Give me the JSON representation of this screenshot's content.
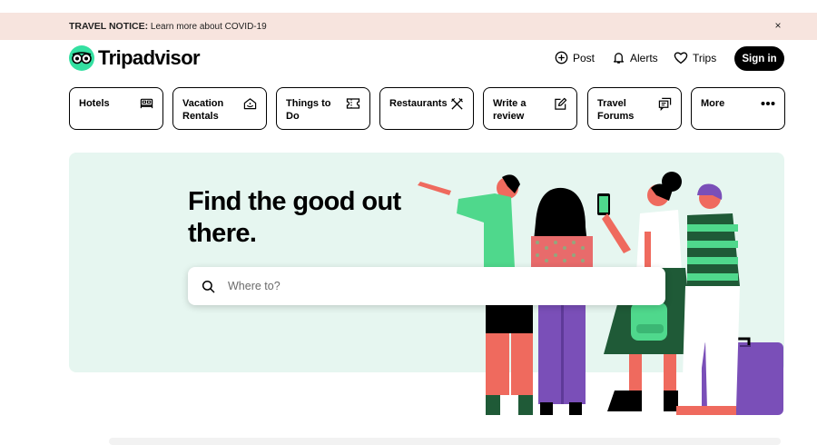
{
  "notice": {
    "title": "TRAVEL NOTICE:",
    "link": "Learn more about COVID-19",
    "close_glyph": "×"
  },
  "header": {
    "logo_text": "Tripadvisor",
    "logo_icon": "owl-eyes-icon",
    "actions": [
      {
        "label": "Post",
        "icon": "plus-circle-icon"
      },
      {
        "label": "Alerts",
        "icon": "bell-icon"
      },
      {
        "label": "Trips",
        "icon": "heart-icon"
      }
    ],
    "signin_label": "Sign in"
  },
  "nav": [
    {
      "label": "Hotels",
      "icon": "bed-icon"
    },
    {
      "label": "Vacation Rentals",
      "icon": "house-icon"
    },
    {
      "label": "Things to Do",
      "icon": "ticket-icon"
    },
    {
      "label": "Restaurants",
      "icon": "fork-knife-icon"
    },
    {
      "label": "Write a review",
      "icon": "pencil-square-icon"
    },
    {
      "label": "Travel Forums",
      "icon": "chat-bubbles-icon"
    },
    {
      "label": "More",
      "icon": "ellipsis-icon"
    }
  ],
  "hero": {
    "title": "Find the good out there.",
    "search_placeholder": "Where to?",
    "search_icon": "search-icon",
    "illustration": "group-of-travelers-illustration"
  },
  "colors": {
    "brand_green": "#34e0a1",
    "notice_bg": "#f7e4de",
    "hero_bg": "#e6f6f0",
    "button_black": "#000000"
  }
}
